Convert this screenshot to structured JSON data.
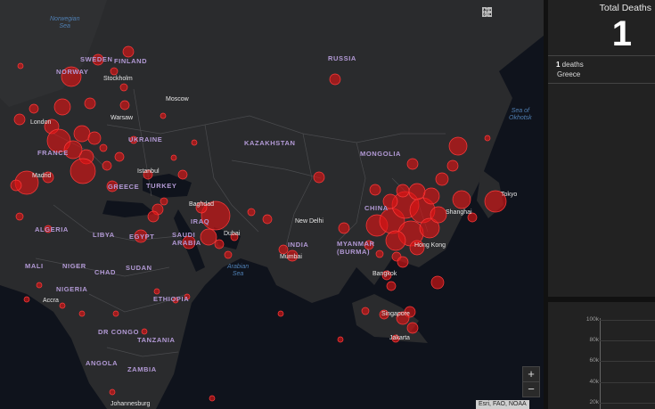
{
  "toolbar": {
    "icons": [
      "bookmark-icon",
      "list-icon",
      "grid-icon"
    ]
  },
  "zoom": {
    "in": "+",
    "out": "−"
  },
  "attribution": "Esri, FAO, NOAA",
  "countries": {
    "norway": "NORWAY",
    "sweden": "SWEDEN",
    "finland": "FINLAND",
    "russia": "RUSSIA",
    "ukraine": "UKRAINE",
    "kazakhstan": "KAZAKHSTAN",
    "mongolia": "MONGOLIA",
    "france": "FRANCE",
    "turkey": "TURKEY",
    "greece": "GREECE",
    "iraq": "IRAQ",
    "algeria": "ALGERIA",
    "libya": "LIBYA",
    "egypt": "EGYPT",
    "saudi_arabia": "SAUDI ARABIA",
    "india": "INDIA",
    "myanmar": "MYANMAR (BURMA)",
    "china": "CHINA",
    "mali": "MALI",
    "niger": "NIGER",
    "chad": "CHAD",
    "sudan": "SUDAN",
    "nigeria": "NIGERIA",
    "ethiopia": "ETHIOPIA",
    "dr_congo": "DR CONGO",
    "tanzania": "TANZANIA",
    "angola": "ANGOLA",
    "zambia": "ZAMBIA"
  },
  "cities": {
    "stockholm": "Stockholm",
    "moscow": "Moscow",
    "warsaw": "Warsaw",
    "london": "London",
    "madrid": "Madrid",
    "istanbul": "Istanbul",
    "baghdad": "Baghdad",
    "dubai": "Dubai",
    "new_delhi": "New Delhi",
    "mumbai": "Mumbai",
    "bangkok": "Bangkok",
    "singapore": "Singapore",
    "jakarta": "Jakarta",
    "accra": "Accra",
    "tokyo": "Tokyo",
    "shanghai": "Shanghai",
    "hong_kong": "Hong Kong",
    "johannesburg": "Johannesburg"
  },
  "seas": {
    "norwegian": "Norwegian\nSea",
    "okhotsk": "Sea of\nOkhotsk",
    "arabian": "Arabian\nSea"
  },
  "panel": {
    "title": "Total Deaths",
    "value": "1",
    "item_count": "1",
    "item_unit": " deaths",
    "item_country": "Greece"
  },
  "chart_data": {
    "type": "line",
    "yticks": [
      "100k",
      "80k",
      "60k",
      "40k",
      "20k"
    ],
    "ylim": [
      20000,
      100000
    ],
    "series": []
  }
}
